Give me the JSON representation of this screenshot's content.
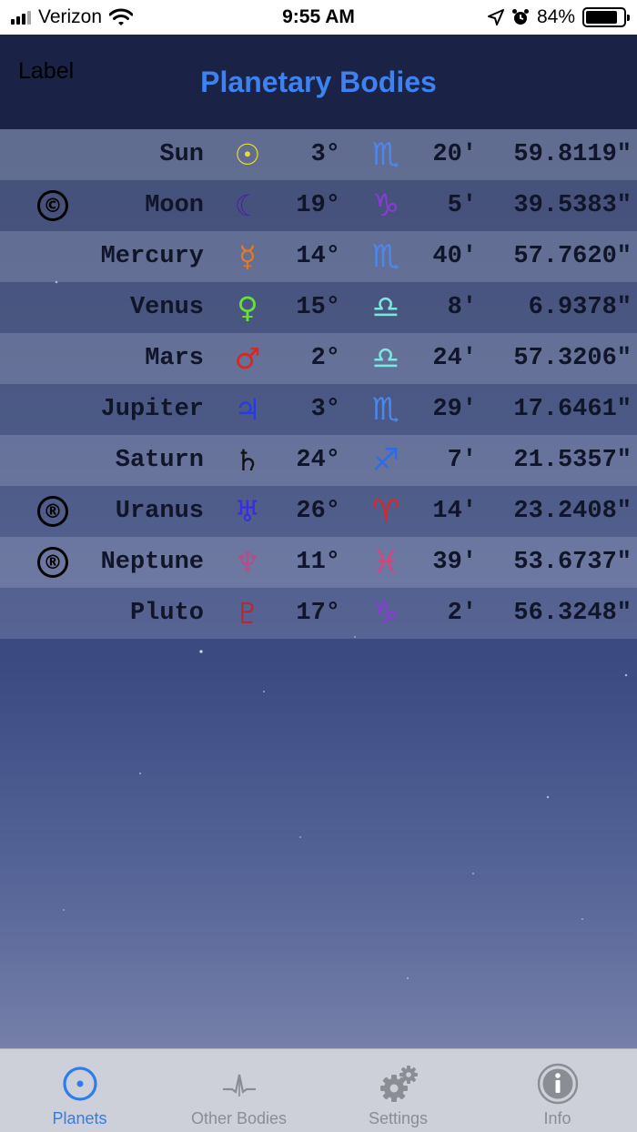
{
  "status_bar": {
    "carrier": "Verizon",
    "time": "9:55 AM",
    "battery": "84%",
    "battery_level": 0.84
  },
  "header": {
    "stray_label": "Label",
    "title": "Planetary Bodies"
  },
  "planets": [
    {
      "mark": "",
      "name": "Sun",
      "planet_symbol": "☉",
      "planet_color": "#e8df2a",
      "degrees": "3°",
      "sign_symbol": "♏",
      "sign_color": "#4b88ee",
      "minutes": "20'",
      "seconds": "59.8119\""
    },
    {
      "mark": "©",
      "name": "Moon",
      "planet_symbol": "☾",
      "planet_color": "#4c21a6",
      "degrees": "19°",
      "sign_symbol": "♑",
      "sign_color": "#8b3ad6",
      "minutes": "5'",
      "seconds": "39.5383\""
    },
    {
      "mark": "",
      "name": "Mercury",
      "planet_symbol": "☿",
      "planet_color": "#e07a2a",
      "degrees": "14°",
      "sign_symbol": "♏",
      "sign_color": "#4b88ee",
      "minutes": "40'",
      "seconds": "57.7620\""
    },
    {
      "mark": "",
      "name": "Venus",
      "planet_symbol": "♀",
      "planet_color": "#68e03a",
      "degrees": "15°",
      "sign_symbol": "♎",
      "sign_color": "#7de6e0",
      "minutes": "8'",
      "seconds": "6.9378\""
    },
    {
      "mark": "",
      "name": "Mars",
      "planet_symbol": "♂",
      "planet_color": "#d42a22",
      "degrees": "2°",
      "sign_symbol": "♎",
      "sign_color": "#7de6e0",
      "minutes": "24'",
      "seconds": "57.3206\""
    },
    {
      "mark": "",
      "name": "Jupiter",
      "planet_symbol": "♃",
      "planet_color": "#2a3ae0",
      "degrees": "3°",
      "sign_symbol": "♏",
      "sign_color": "#4b88ee",
      "minutes": "29'",
      "seconds": "17.6461\""
    },
    {
      "mark": "",
      "name": "Saturn",
      "planet_symbol": "♄",
      "planet_color": "#111111",
      "degrees": "24°",
      "sign_symbol": "♐",
      "sign_color": "#2f6be8",
      "minutes": "7'",
      "seconds": "21.5357\""
    },
    {
      "mark": "®",
      "name": "Uranus",
      "planet_symbol": "♅",
      "planet_color": "#3a2ce0",
      "degrees": "26°",
      "sign_symbol": "♈",
      "sign_color": "#d8262a",
      "minutes": "14'",
      "seconds": "23.2408\""
    },
    {
      "mark": "®",
      "name": "Neptune",
      "planet_symbol": "♆",
      "planet_color": "#b0508a",
      "degrees": "11°",
      "sign_symbol": "♓",
      "sign_color": "#e0407a",
      "minutes": "39'",
      "seconds": "53.6737\""
    },
    {
      "mark": "",
      "name": "Pluto",
      "planet_symbol": "♇",
      "planet_color": "#b22a38",
      "degrees": "17°",
      "sign_symbol": "♑",
      "sign_color": "#8b3ad6",
      "minutes": "2'",
      "seconds": "56.3248\""
    }
  ],
  "tab_bar": {
    "tabs": [
      {
        "label": "Planets",
        "icon": "planets-icon",
        "active": true
      },
      {
        "label": "Other Bodies",
        "icon": "other-bodies-icon",
        "active": false
      },
      {
        "label": "Settings",
        "icon": "gear-icon",
        "active": false
      },
      {
        "label": "Info",
        "icon": "info-icon",
        "active": false
      }
    ]
  }
}
